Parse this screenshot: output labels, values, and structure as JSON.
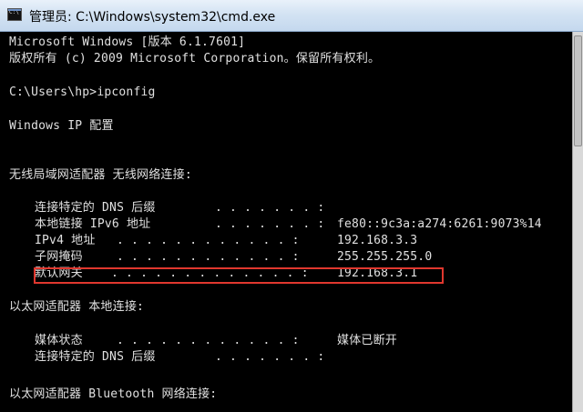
{
  "window": {
    "title": "管理员: C:\\Windows\\system32\\cmd.exe",
    "accent": "#e0372e"
  },
  "console": {
    "header": [
      "Microsoft Windows [版本 6.1.7601]",
      "版权所有 (c) 2009 Microsoft Corporation。保留所有权利。"
    ],
    "prompt": "C:\\Users\\hp>ipconfig",
    "ip_config_title": "Windows IP 配置",
    "adapters": [
      {
        "heading": "无线局域网适配器 无线网络连接:",
        "rows": [
          {
            "label": "连接特定的 DNS 后缀",
            "dots": ". . . . . . . :",
            "value": ""
          },
          {
            "label": "本地链接 IPv6 地址",
            "dots": ". . . . . . . :",
            "value": "fe80::9c3a:a274:6261:9073%14"
          },
          {
            "label": "IPv4 地址",
            "dots": ". . . . . . . . . . . . :",
            "value": "192.168.3.3"
          },
          {
            "label": "子网掩码",
            "dots": ". . . . . . . . . . . . :",
            "value": "255.255.255.0"
          },
          {
            "label": "默认网关",
            "dots": ". . . . . . . . . . . . . :",
            "value": "192.168.3.1"
          }
        ]
      },
      {
        "heading": "以太网适配器 本地连接:",
        "rows": [
          {
            "label": "媒体状态",
            "dots": ". . . . . . . . . . . . :",
            "value": "媒体已断开"
          },
          {
            "label": "连接特定的 DNS 后缀",
            "dots": ". . . . . . . :",
            "value": ""
          }
        ]
      },
      {
        "heading": "以太网适配器 Bluetooth 网络连接:",
        "rows": []
      }
    ]
  }
}
